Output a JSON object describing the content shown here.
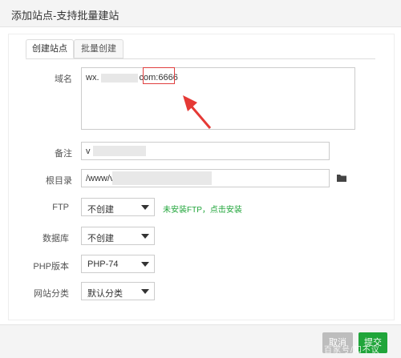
{
  "window": {
    "title": "添加站点-支持批量建站"
  },
  "tabs": [
    {
      "label": "创建站点",
      "active": true
    },
    {
      "label": "批量创建",
      "active": false
    }
  ],
  "form": {
    "domain": {
      "label": "域名",
      "value_prefix": "wx.",
      "value_mid": "com:",
      "value_port": "6666"
    },
    "remark": {
      "label": "备注",
      "value": "v"
    },
    "root": {
      "label": "根目录",
      "value": "/www/v"
    },
    "ftp": {
      "label": "FTP",
      "selected": "不创建",
      "hint": "未安装FTP，点击安装"
    },
    "database": {
      "label": "数据库",
      "selected": "不创建"
    },
    "php": {
      "label": "PHP版本",
      "selected": "PHP-74"
    },
    "category": {
      "label": "网站分类",
      "selected": "默认分类"
    }
  },
  "footer": {
    "cancel_label": "取消",
    "submit_label": "提交"
  },
  "watermark": "百家号/知不议",
  "colors": {
    "accent": "#20a53a",
    "highlight_border": "#e04040",
    "annotation_arrow": "#e53935"
  }
}
